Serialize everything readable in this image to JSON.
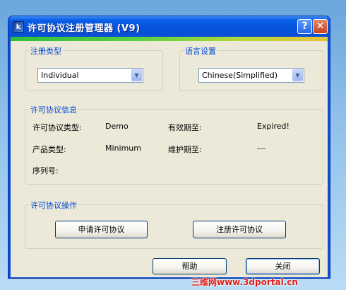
{
  "window": {
    "title": "许可协议注册管理器 (V9)",
    "help_glyph": "?",
    "close_glyph": "✕"
  },
  "registration_type": {
    "label": "注册类型",
    "selected": "Individual"
  },
  "language": {
    "label": "语言设置",
    "selected": "Chinese(Simplified)"
  },
  "license_info": {
    "label": "许可协议信息",
    "license_type_label": "许可协议类型:",
    "license_type_value": "Demo",
    "valid_until_label": "有效期至:",
    "valid_until_value": "Expired!",
    "product_type_label": "产品类型:",
    "product_type_value": "Minimum",
    "maintenance_label": "维护期至:",
    "maintenance_value": "---",
    "serial_label": "序列号:"
  },
  "license_ops": {
    "label": "许可协议操作",
    "request_button": "申请许可协议",
    "register_button": "注册许可协议"
  },
  "footer": {
    "help_button": "帮助",
    "close_button": "关闭"
  },
  "watermark": "三维网www.3dportal.cn",
  "icons": {
    "app": "app-icon",
    "dropdown": "chevron-down-icon"
  }
}
